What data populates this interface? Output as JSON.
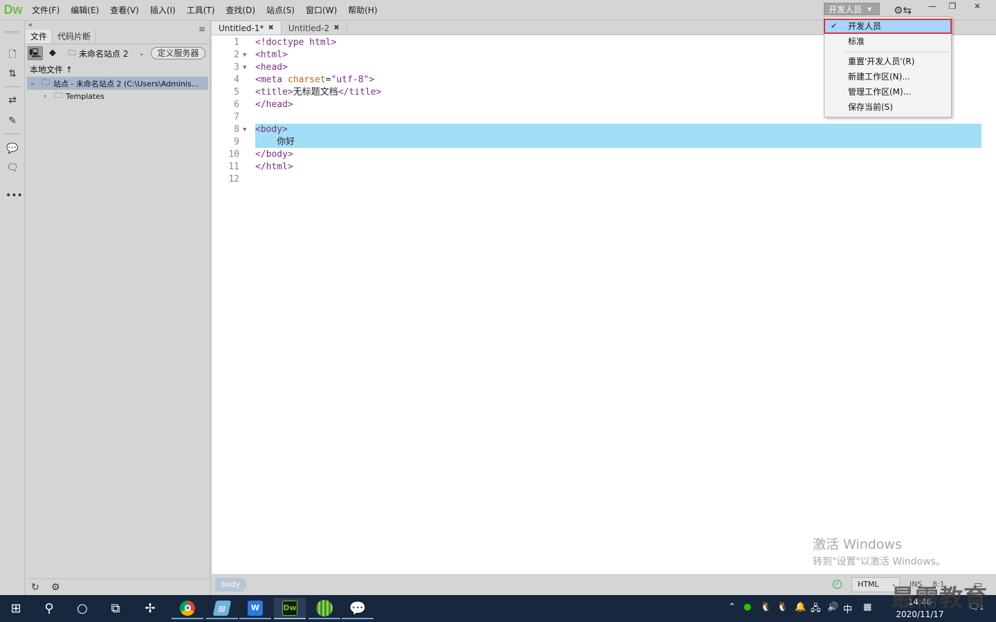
{
  "app": {
    "logo": "Dw"
  },
  "menu": [
    "文件(F)",
    "编辑(E)",
    "查看(V)",
    "插入(I)",
    "工具(T)",
    "查找(D)",
    "站点(S)",
    "窗口(W)",
    "帮助(H)"
  ],
  "workspace": {
    "current": "开发人员",
    "dropdown": {
      "checked": "开发人员",
      "items": [
        "标准"
      ],
      "actions": [
        "重置'开发人员'(R)",
        "新建工作区(N)...",
        "管理工作区(M)...",
        "保存当前(S)"
      ]
    }
  },
  "files_panel": {
    "tabs": [
      "文件",
      "代码片断"
    ],
    "site_name": "未命名站点 2",
    "define_server": "定义服务器",
    "local_files": "本地文件",
    "sort_arrow": "↑",
    "tree": [
      {
        "label": "站点 - 未命名站点 2 (C:\\Users\\Adminis...",
        "expanded": true,
        "selected": true
      },
      {
        "label": "Templates",
        "expanded": false,
        "selected": false
      }
    ]
  },
  "doc_tabs": [
    "Untitled-1*",
    "Untitled-2"
  ],
  "code_lines": [
    "<!doctype html>",
    "<html>",
    "<head>",
    "<meta charset=\"utf-8\">",
    "<title>无标题文档</title>",
    "</head>",
    "",
    "<body>",
    "    你好",
    "</body>",
    "</html>",
    ""
  ],
  "line_numbers": [
    "1",
    "2",
    "3",
    "4",
    "5",
    "6",
    "7",
    "8",
    "9",
    "10",
    "11",
    "12"
  ],
  "watermark": {
    "line1": "激活 Windows",
    "line2": "转到\"设置\"以激活 Windows。"
  },
  "status": {
    "breadcrumb": "body",
    "language": "HTML",
    "mode": "INS",
    "position": "8:1"
  },
  "taskbar": {
    "clock_time": "14:46",
    "clock_date": "2020/11/17",
    "ime": "中",
    "notification_count": "1"
  },
  "brand_watermark": "最需教育",
  "colors": {
    "selection": "#a2def5",
    "highlight_border": "#e0303c",
    "dw_green": "#6fbe44",
    "taskbar": "#17273d"
  }
}
